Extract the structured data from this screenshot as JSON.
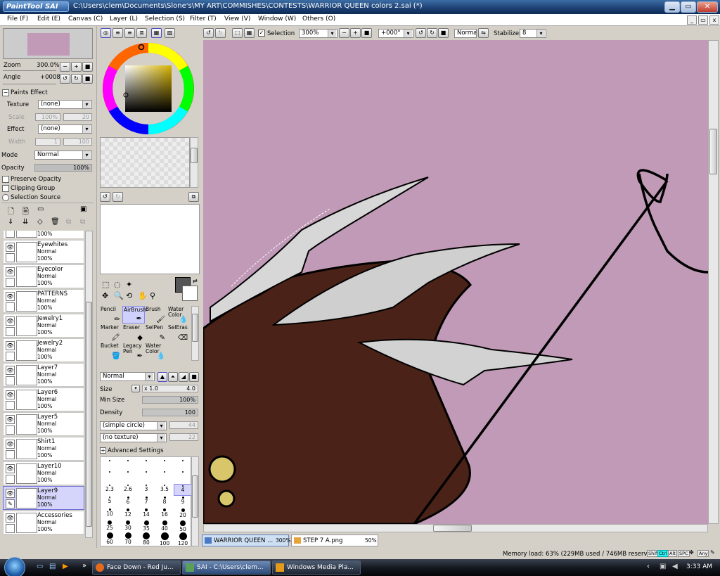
{
  "window": {
    "logo": "PaintTool SAI",
    "title": "C:\\Users\\clem\\Documents\\Slone's\\MY ART\\COMMISHES\\CONTESTS\\WARRIOR QUEEN colors 2.sai (*)"
  },
  "menu": [
    "File (F)",
    "Edit (E)",
    "Canvas (C)",
    "Layer (L)",
    "Selection (S)",
    "Filter (T)",
    "View (V)",
    "Window (W)",
    "Others (O)"
  ],
  "navigator": {
    "zoom_label": "Zoom",
    "zoom_value": "300.0%",
    "angle_label": "Angle",
    "angle_value": "+0008"
  },
  "paints_effect": {
    "header": "Paints Effect",
    "texture_label": "Texture",
    "texture_value": "(none)",
    "scale_label": "Scale",
    "scale_value": "100%",
    "scale_num": "20",
    "effect_label": "Effect",
    "effect_value": "(none)",
    "width_label": "Width",
    "width_value": "1",
    "width_num": "100"
  },
  "layer_props": {
    "mode_label": "Mode",
    "mode_value": "Normal",
    "opacity_label": "Opacity",
    "opacity_value": "100%",
    "preserve_opacity": "Preserve Opacity",
    "clipping_group": "Clipping Group",
    "selection_source": "Selection Source"
  },
  "layers": [
    {
      "name": "",
      "mode": "Normal",
      "opacity": "100%",
      "visible": false,
      "selected": false
    },
    {
      "name": "Eyewhites",
      "mode": "Normal",
      "opacity": "100%",
      "visible": true,
      "selected": false
    },
    {
      "name": "Eyecolor",
      "mode": "Normal",
      "opacity": "100%",
      "visible": true,
      "selected": false
    },
    {
      "name": "PATTERNS",
      "mode": "Normal",
      "opacity": "100%",
      "visible": true,
      "selected": false
    },
    {
      "name": "Jewelry1",
      "mode": "Normal",
      "opacity": "100%",
      "visible": true,
      "selected": false
    },
    {
      "name": "Jewelry2",
      "mode": "Normal",
      "opacity": "100%",
      "visible": true,
      "selected": false
    },
    {
      "name": "Layer7",
      "mode": "Normal",
      "opacity": "100%",
      "visible": true,
      "selected": false
    },
    {
      "name": "Layer6",
      "mode": "Normal",
      "opacity": "100%",
      "visible": true,
      "selected": false
    },
    {
      "name": "Layer5",
      "mode": "Normal",
      "opacity": "100%",
      "visible": true,
      "selected": false
    },
    {
      "name": "Shirt1",
      "mode": "Normal",
      "opacity": "100%",
      "visible": true,
      "selected": false
    },
    {
      "name": "Layer10",
      "mode": "Normal",
      "opacity": "100%",
      "visible": true,
      "selected": false
    },
    {
      "name": "Layer9",
      "mode": "Normal",
      "opacity": "100%",
      "visible": true,
      "selected": true
    },
    {
      "name": "Accessories",
      "mode": "Normal",
      "opacity": "100%",
      "visible": true,
      "selected": false
    }
  ],
  "tools": [
    {
      "name": "Pencil",
      "selected": false
    },
    {
      "name": "AirBrush",
      "selected": true
    },
    {
      "name": "Brush",
      "selected": false
    },
    {
      "name": "Water Color",
      "selected": false
    },
    {
      "name": "Marker",
      "selected": false
    },
    {
      "name": "Eraser",
      "selected": false
    },
    {
      "name": "SelPen",
      "selected": false
    },
    {
      "name": "SelEras",
      "selected": false
    },
    {
      "name": "Bucket",
      "selected": false
    },
    {
      "name": "Legacy Pen",
      "selected": false
    },
    {
      "name": "Water Color",
      "selected": false
    }
  ],
  "brush": {
    "mode_value": "Normal",
    "size_label": "Size",
    "size_mult": "x 1.0",
    "size_value": "4.0",
    "min_size_label": "Min Size",
    "min_size_value": "100%",
    "density_label": "Density",
    "density_value": "100",
    "shape_value": "(simple circle)",
    "shape_num": "44",
    "texture_value": "(no texture)",
    "texture_num": "22",
    "advanced": "Advanced Settings",
    "presets": [
      "2.3",
      "2.6",
      "3",
      "3.5",
      "4",
      "5",
      "6",
      "7",
      "8",
      "9",
      "10",
      "12",
      "14",
      "16",
      "20",
      "25",
      "30",
      "35",
      "40",
      "50",
      "60",
      "70",
      "80",
      "100",
      "120"
    ],
    "selected_preset": "4"
  },
  "toolbar": {
    "selection_label": "Selection",
    "zoom_value": "300%",
    "angle_value": "+000°",
    "blend_value": "Normal",
    "stabilizer_label": "Stabilizer",
    "stabilizer_value": "8"
  },
  "tabs": [
    {
      "name": "WARRIOR QUEEN ...",
      "zoom": "300%",
      "active": true
    },
    {
      "name": "STEP 7 A.png",
      "zoom": "50%",
      "active": false
    }
  ],
  "status": {
    "memory": "Memory load: 63% (229MB used / 746MB reserved)",
    "keys": [
      "Shift",
      "Ctrl",
      "Alt",
      "SPC",
      "Any"
    ]
  },
  "taskbar": {
    "items": [
      {
        "label": "Face Down - Red Ju...",
        "active": false
      },
      {
        "label": "SAI - C:\\Users\\clem...",
        "active": true
      },
      {
        "label": "Windows Media Pla...",
        "active": false
      }
    ],
    "clock": "3:33 AM"
  },
  "colors": {
    "canvas": "#c09ab6",
    "hair": "#4a2218",
    "primary_swatch": "#555555",
    "selected_bg": "#d5d4fa"
  }
}
